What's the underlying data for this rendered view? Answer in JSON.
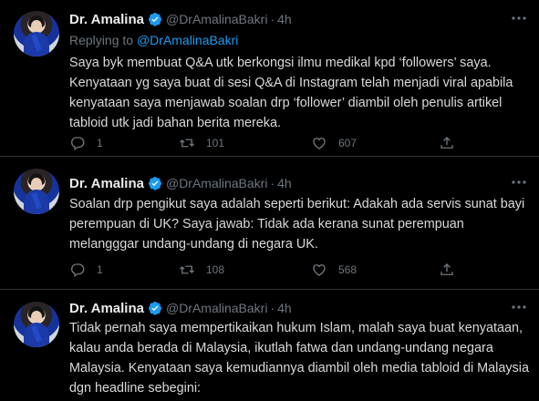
{
  "tweets": [
    {
      "author_name": "Dr. Amalina",
      "handle": "@DrAmalinaBakri",
      "separator": "·",
      "time": "4h",
      "replying_prefix": "Replying to ",
      "replying_handle": "@DrAmalinaBakri",
      "text": "Saya byk membuat Q&A utk berkongsi ilmu medikal kpd ‘followers’ saya. Kenyataan yg saya buat di sesi Q&A di Instagram telah menjadi viral apabila kenyataan saya menjawab soalan drp ‘follower’ diambil oleh penulis artikel tabloid utk jadi bahan berita mereka.",
      "replies": "1",
      "retweets": "101",
      "likes": "607"
    },
    {
      "author_name": "Dr. Amalina",
      "handle": "@DrAmalinaBakri",
      "separator": "·",
      "time": "4h",
      "text": "Soalan drp pengikut saya adalah seperti berikut: Adakah ada servis sunat bayi perempuan di UK? Saya jawab: Tidak ada kerana sunat perempuan melangggar undang-undang di negara UK.",
      "replies": "1",
      "retweets": "108",
      "likes": "568"
    },
    {
      "author_name": "Dr. Amalina",
      "handle": "@DrAmalinaBakri",
      "separator": "·",
      "time": "4h",
      "text": "Tidak pernah saya mempertikaikan hukum Islam, malah saya buat kenyataan, kalau anda berada di Malaysia, ikutlah fatwa dan undang-undang negara Malaysia. Kenyataan saya kemudiannya diambil oleh media tabloid di Malaysia dgn headline sebegini:"
    }
  ],
  "icons": {
    "verified": "verified-badge-icon",
    "more": "more-dots-icon",
    "reply": "reply-icon",
    "retweet": "retweet-icon",
    "like": "like-icon",
    "share": "share-icon"
  },
  "colors": {
    "background": "#000000",
    "text": "#d9d9d9",
    "muted": "#6e767d",
    "accent": "#1d9bf0",
    "divider": "#2f3336"
  }
}
